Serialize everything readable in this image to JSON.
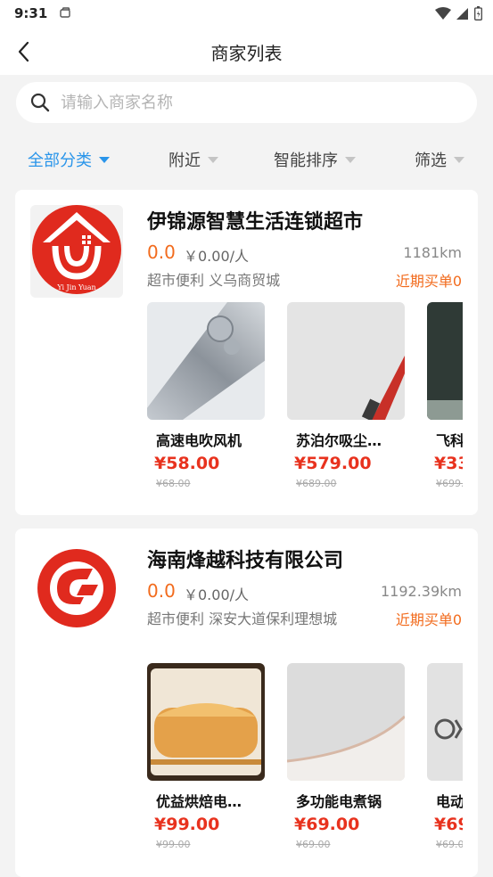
{
  "status_bar": {
    "time": "9:31"
  },
  "header": {
    "title": "商家列表"
  },
  "search": {
    "placeholder": "请输入商家名称"
  },
  "filters": [
    {
      "label": "全部分类",
      "active": true
    },
    {
      "label": "附近",
      "active": false
    },
    {
      "label": "智能排序",
      "active": false
    },
    {
      "label": "筛选",
      "active": false
    }
  ],
  "colors": {
    "accent_blue": "#2a95ea",
    "price_red": "#e8321e",
    "orange": "#f26b1d"
  },
  "merchants": [
    {
      "name": "伊锦源智慧生活连锁超市",
      "logo_text": "Yi Jin Yuan",
      "rating": "0.0",
      "avg_price": "￥0.00/人",
      "distance": "1181km",
      "tags": "超市便利 义乌商贸城",
      "recent_sales": "近期买单0",
      "products": [
        {
          "name": "高速电吹风机",
          "price": "¥58.00",
          "old_price": "¥68.00"
        },
        {
          "name": "苏泊尔吸尘…",
          "price": "¥579.00",
          "old_price": "¥689.00"
        },
        {
          "name": "飞科",
          "price": "¥33",
          "old_price": "¥699."
        }
      ]
    },
    {
      "name": "海南烽越科技有限公司",
      "rating": "0.0",
      "avg_price": "￥0.00/人",
      "distance": "1192.39km",
      "tags": "超市便利 深安大道保利理想城",
      "recent_sales": "近期买单0",
      "products": [
        {
          "name": "优益烘焙电…",
          "price": "¥99.00",
          "old_price": "¥99.00"
        },
        {
          "name": "多功能电煮锅",
          "price": "¥69.00",
          "old_price": "¥69.00"
        },
        {
          "name": "电动",
          "price": "¥69",
          "old_price": "¥69.0"
        }
      ]
    }
  ]
}
